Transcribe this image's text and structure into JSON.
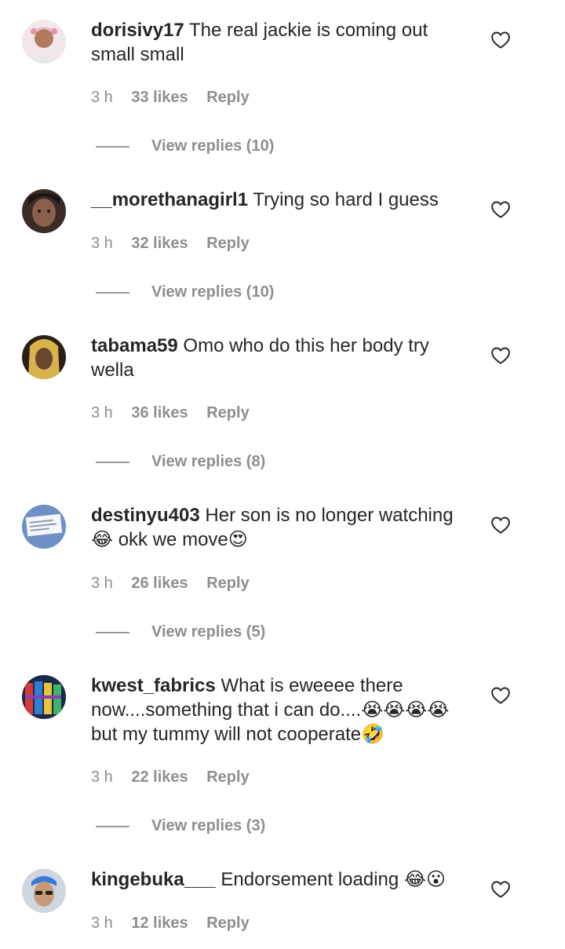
{
  "comments": [
    {
      "username": "dorisivy17",
      "text": "The real jackie is coming out small small",
      "time": "3 h",
      "likes": "33 likes",
      "reply": "Reply",
      "view_replies": "View replies (10)"
    },
    {
      "username": "__morethanagirl1",
      "text": "Trying so hard I guess",
      "time": "3 h",
      "likes": "32 likes",
      "reply": "Reply",
      "view_replies": "View replies (10)"
    },
    {
      "username": "tabama59",
      "text": "Omo who do this her body try wella",
      "time": "3 h",
      "likes": "36 likes",
      "reply": "Reply",
      "view_replies": "View replies (8)"
    },
    {
      "username": "destinyu403",
      "text": "Her son is no longer watching 😂 okk we move😍",
      "time": "3 h",
      "likes": "26 likes",
      "reply": "Reply",
      "view_replies": "View replies (5)"
    },
    {
      "username": "kwest_fabrics",
      "text": "What is eweeee there now....something that i can do....😭😭😭😭 but my tummy will not cooperate🤣",
      "time": "3 h",
      "likes": "22 likes",
      "reply": "Reply",
      "view_replies": "View replies (3)"
    },
    {
      "username": "kingebuka___",
      "text": "Endorsement loading 😂😮",
      "time": "3 h",
      "likes": "12 likes",
      "reply": "Reply"
    }
  ],
  "icons": {
    "like": "heart-outline-icon"
  },
  "colors": {
    "text": "#262626",
    "secondary": "#8e8e8e"
  }
}
